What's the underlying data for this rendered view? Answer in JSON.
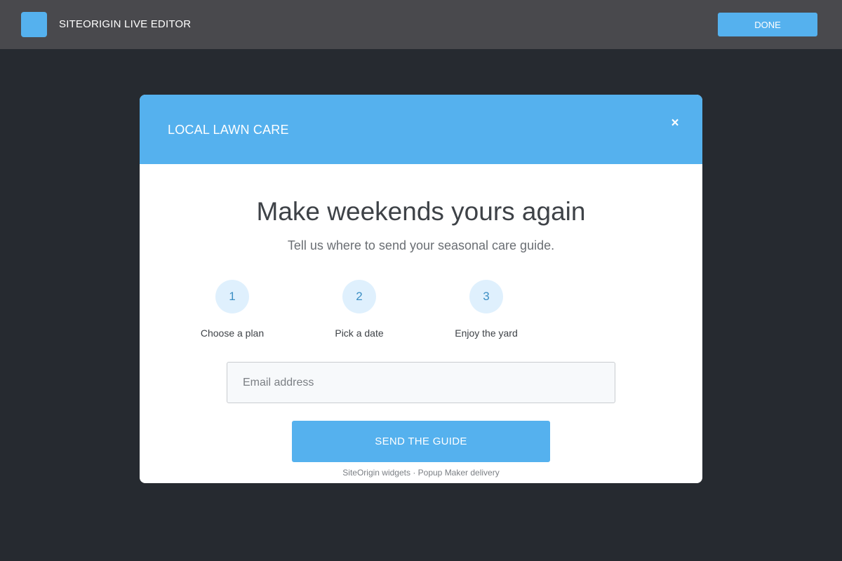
{
  "topbar": {
    "logo_icon": "siteorigin-logo-icon",
    "title": "SITEORIGIN LIVE EDITOR",
    "done_label": "DONE"
  },
  "modal": {
    "title": "LOCAL LAWN CARE",
    "close_glyph": "×",
    "headline": "Make weekends yours again",
    "subhead": "Tell us where to send your seasonal care guide.",
    "steps": [
      {
        "number": "1",
        "label": "Choose a plan"
      },
      {
        "number": "2",
        "label": "Pick a date"
      },
      {
        "number": "3",
        "label": "Enjoy the yard"
      }
    ],
    "email": {
      "value": "",
      "placeholder": "Email address"
    },
    "submit_label": "SEND THE GUIDE",
    "footer_note": "SiteOrigin widgets · Popup Maker delivery"
  },
  "colors": {
    "accent": "#55b1ee",
    "topbar_bg": "#49494d",
    "page_bg": "#262a30",
    "step_circle_bg": "#dff0fd"
  }
}
